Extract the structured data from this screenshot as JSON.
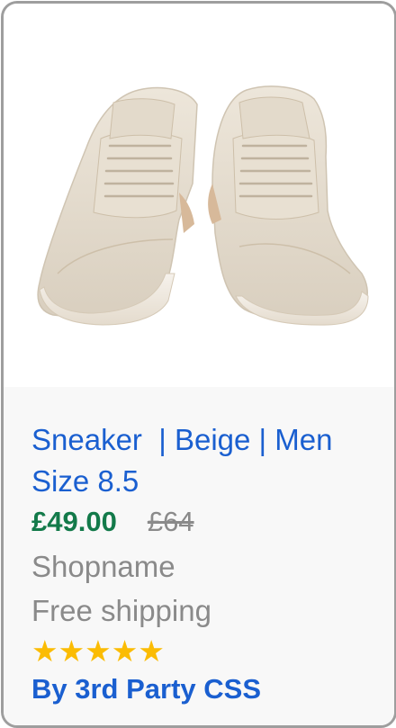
{
  "product": {
    "title": "Sneaker  | Beige | Men\nSize 8.5",
    "price": "£49.00",
    "old_price": "£64",
    "shop": "Shopname",
    "shipping": "Free shipping",
    "stars": "★★★★★",
    "rating": 5,
    "rating_max": 5,
    "seller": "By 3rd Party CSS",
    "image_icon": "sneaker-pair-image"
  },
  "colors": {
    "title_link": "#1a5fd0",
    "price": "#137a4a",
    "muted": "#8a8a8a",
    "stars": "#fbbc04",
    "border": "#9e9e9e",
    "info_bg": "#f8f8f8"
  }
}
